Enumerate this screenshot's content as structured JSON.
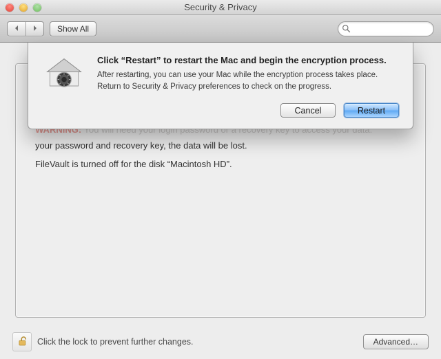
{
  "window": {
    "title": "Security & Privacy"
  },
  "toolbar": {
    "show_all_label": "Show All",
    "search_placeholder": ""
  },
  "sheet": {
    "title": "Click “Restart” to restart the Mac and begin the encryption process.",
    "message": "After restarting, you can use your Mac while the encryption process takes place. Return to Security & Privacy preferences to check on the progress.",
    "cancel_label": "Cancel",
    "restart_label": "Restart",
    "icon": "house-safe-dial-icon"
  },
  "panel": {
    "obscured_warning_label": "WARNING:",
    "obscured_text": "You will need your login password or a recovery key to access your data.",
    "recovery_line": "your password and recovery key, the data will be lost.",
    "status_line": "FileVault is turned off for the disk “Macintosh HD”."
  },
  "bottom": {
    "lock_text": "Click the lock to prevent further changes.",
    "advanced_label": "Advanced…"
  }
}
